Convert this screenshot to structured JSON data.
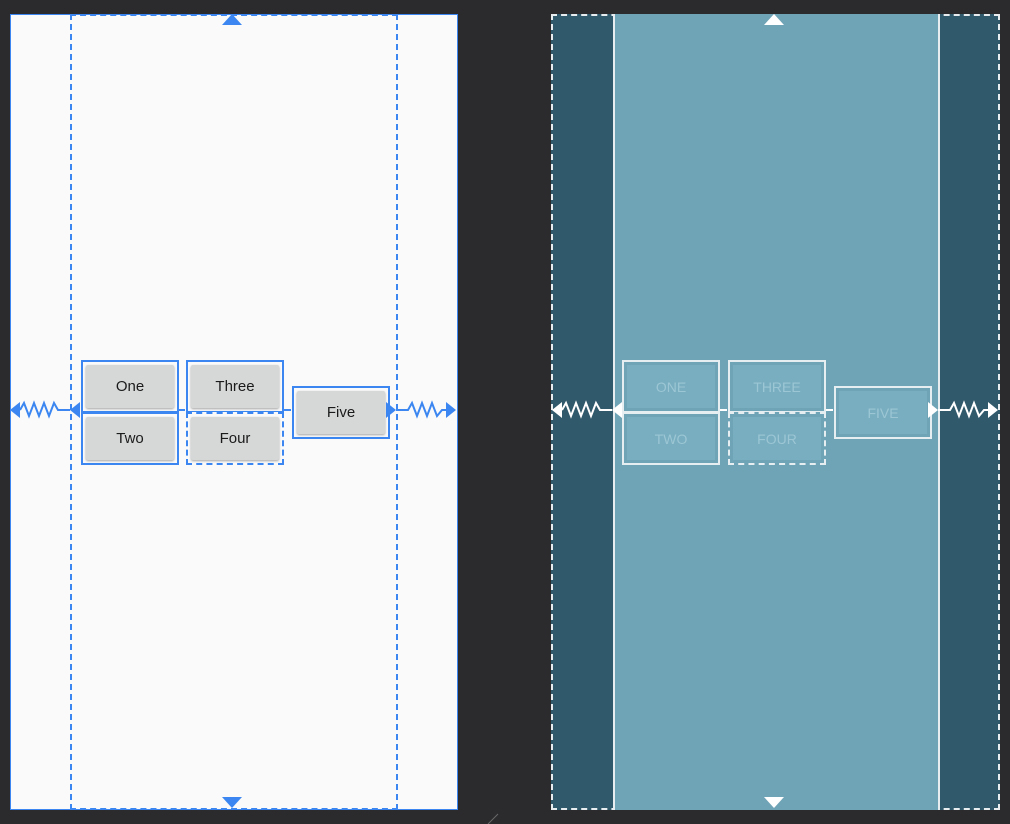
{
  "design_view": {
    "buttons": [
      {
        "label": "One"
      },
      {
        "label": "Two"
      },
      {
        "label": "Three"
      },
      {
        "label": "Four"
      },
      {
        "label": "Five"
      }
    ]
  },
  "blueprint_view": {
    "buttons": [
      {
        "label": "ONE"
      },
      {
        "label": "TWO"
      },
      {
        "label": "THREE"
      },
      {
        "label": "FOUR"
      },
      {
        "label": "FIVE"
      }
    ]
  },
  "colors": {
    "background": "#2b2b2d",
    "design_surface": "#fafafa",
    "selection_blue": "#3b86f0",
    "button_fill": "#d6d7d7",
    "blueprint_outer": "#30596b",
    "blueprint_parent": "#6fa3b6",
    "blueprint_line": "#e8eef0"
  },
  "icons": {
    "top_anchor": "triangle-up-icon",
    "bottom_anchor": "triangle-down-icon",
    "chain_spring": "zigzag-spring-icon",
    "resize_handle": "resize-corner-icon"
  }
}
